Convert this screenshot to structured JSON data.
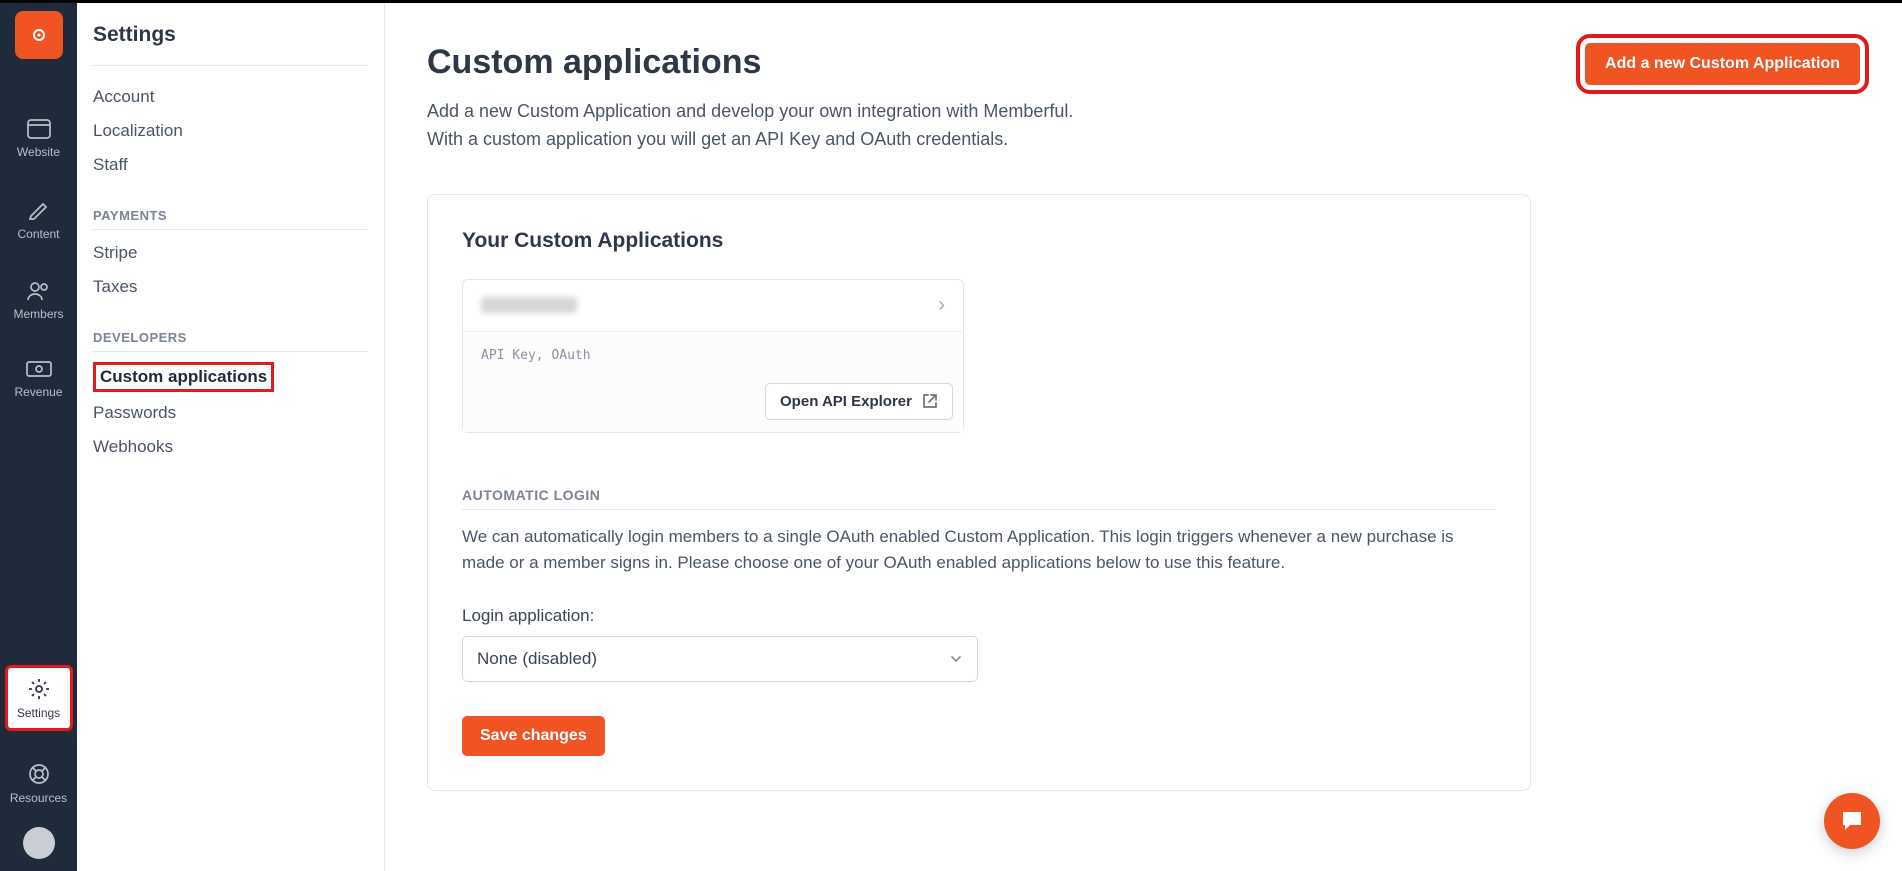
{
  "rail": {
    "items": [
      {
        "label": "Website"
      },
      {
        "label": "Content"
      },
      {
        "label": "Members"
      },
      {
        "label": "Revenue"
      }
    ],
    "settings_label": "Settings",
    "resources_label": "Resources"
  },
  "settings_sidebar": {
    "title": "Settings",
    "general": [
      {
        "label": "Account"
      },
      {
        "label": "Localization"
      },
      {
        "label": "Staff"
      }
    ],
    "payments_header": "PAYMENTS",
    "payments": [
      {
        "label": "Stripe"
      },
      {
        "label": "Taxes"
      }
    ],
    "developers_header": "DEVELOPERS",
    "developers": [
      {
        "label": "Custom applications",
        "active": true
      },
      {
        "label": "Passwords"
      },
      {
        "label": "Webhooks"
      }
    ]
  },
  "main": {
    "title": "Custom applications",
    "subtitle_line1": "Add a new Custom Application and develop your own integration with Memberful.",
    "subtitle_line2": "With a custom application you will get an API Key and OAuth credentials.",
    "add_button": "Add a new Custom Application",
    "card_title": "Your Custom Applications",
    "app_meta": "API Key, OAuth",
    "open_api_explorer": "Open API Explorer",
    "auto_login_header": "AUTOMATIC LOGIN",
    "auto_login_text": "We can automatically login members to a single OAuth enabled Custom Application. This login triggers whenever a new purchase is made or a member signs in. Please choose one of your OAuth enabled applications below to use this feature.",
    "login_app_label": "Login application:",
    "login_app_value": "None (disabled)",
    "save_button": "Save changes"
  },
  "colors": {
    "accent": "#f05423",
    "highlight": "#e11b1b"
  }
}
